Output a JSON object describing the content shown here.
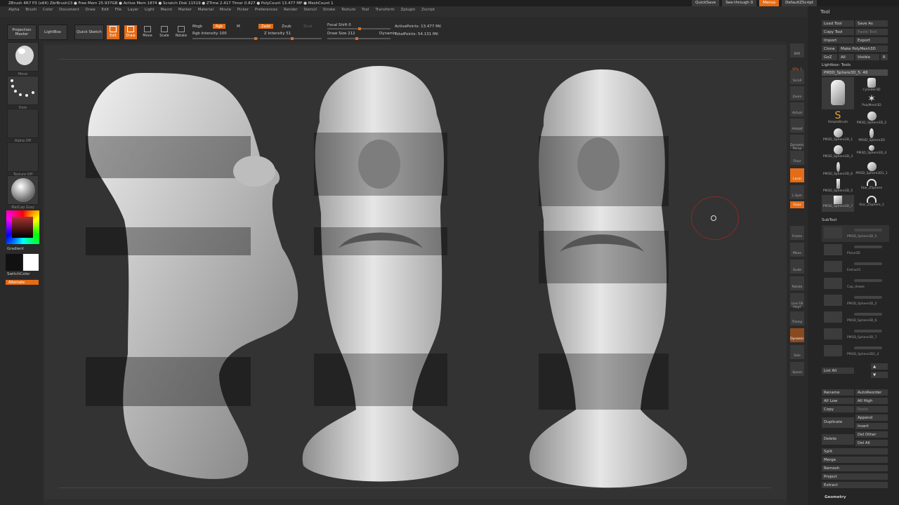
{
  "titlebar": "ZBrush 4R7 P3 (x64)    ZbrBrush13    ● Free Mem 25.937GB ● Active Mem 1874 ● Scratch Disk 11519 ● ZTime 2.417 Timer 0.827 ● PolyCount 13.477 MP ● MeshCount 1",
  "menu": [
    "Alpha",
    "Brush",
    "Color",
    "Document",
    "Draw",
    "Edit",
    "File",
    "Layer",
    "Light",
    "Macro",
    "Marker",
    "Material",
    "Movie",
    "Picker",
    "Preferences",
    "Render",
    "Stencil",
    "Stroke",
    "Texture",
    "Tool",
    "Transform",
    "Zplugin",
    "Zscript"
  ],
  "topright": {
    "quicksave": "QuickSave",
    "seethrough": "See-through  0",
    "menus": "Menus",
    "script": "DefaultZScript"
  },
  "shelf": {
    "projection_master": "Projection Master",
    "lightbox": "LightBox",
    "quick_sketch": "Quick Sketch",
    "edit": "Edit",
    "draw": "Draw",
    "move": "Move",
    "scale": "Scale",
    "rotate": "Rotate",
    "mrgb": "Mrgb",
    "rgb": "Rgb",
    "m": "M",
    "rgb_intensity": "Rgb Intensity 100",
    "zadd": "Zadd",
    "zsub": "Zsub",
    "zcut": "Zcut",
    "z_intensity": "Z Intensity 51",
    "focal_shift": "Focal Shift 0",
    "draw_size": "Draw Size 212",
    "dynamic": "Dynamic",
    "active_points": "ActivePoints: 13.477 Mil",
    "total_points": "TotalPoints: 54.131 Mil"
  },
  "left_tray": {
    "brush": "Move",
    "stroke": "Dots",
    "alpha": "Alpha Off",
    "texture": "Texture Off",
    "material": "MatCap Gray",
    "gradient": "Gradient",
    "switch_color": "SwitchColor",
    "alternate": "Alternate"
  },
  "right_dock": [
    "BPR",
    "SPix 3",
    "Scroll",
    "Zoom",
    "Actual",
    "AAHalf",
    "Dynamic Persp",
    "Floor",
    "Local",
    "L.Sym",
    "Gxyz",
    "Frame",
    "Move",
    "Scale",
    "Rotate",
    "Line Fill PolyF",
    "Transp",
    "Dynamic",
    "Solo",
    "Xpose"
  ],
  "tool_panel": {
    "title": "Tool",
    "load_tool": "Load Tool",
    "save_as": "Save As",
    "copy_tool": "Copy Tool",
    "paste_tool": "Paste Tool",
    "import": "Import",
    "export": "Export",
    "clone": "Clone",
    "make_polymesh": "Make PolyMesh3D",
    "goz": "GoZ",
    "all": "All",
    "visible": "Visible",
    "r": "R",
    "lightbox_tools": "Lightbox› Tools",
    "current_tool": "PM3D_Sphere3D_5. 48",
    "thumbs": [
      "",
      "Cylinder3D",
      "PolyMesh3D",
      "SimpleBrush",
      "PM3D_Sphere3D_2",
      "PM3D_Sphere3D_1",
      "PM3D_Sphere3D",
      "PM3D_Sphere3D_3",
      "PM3D_Sphere3D_4",
      "PM3D_Sphere3D_6",
      "PM3D_Sphere3D1_1",
      "PM3D_Sphere3D_5",
      "Star_ZSphere",
      "PM3D_Sphere3D_7",
      "Star_ZSphere_1"
    ],
    "subtool": "SubTool",
    "subtools": [
      "PM3D_Sphere3D_5",
      "Plane3D",
      "Extract3",
      "Cap_drawe",
      "PM3D_Sphere3D_2",
      "PM3D_Sphere3D_6",
      "PM3D_Sphere3D_7",
      "PM3D_Sphere3D1_4"
    ],
    "list_all": "List All",
    "rename": "Rename",
    "autoreorder": "AutoReorder",
    "all_low": "All Low",
    "all_high": "All High",
    "copy": "Copy",
    "paste": "Paste",
    "duplicate": "Duplicate",
    "append": "Append",
    "insert": "Insert",
    "delete": "Delete",
    "del_other": "Del Other",
    "del_all": "Del All",
    "split": "Split",
    "merge": "Merge",
    "remesh": "Remesh",
    "project": "Project",
    "extract": "Extract",
    "geometry": "Geometry"
  },
  "colors": {
    "accent": "#e46c17",
    "bg": "#2e2e2e",
    "panel": "#252525"
  }
}
